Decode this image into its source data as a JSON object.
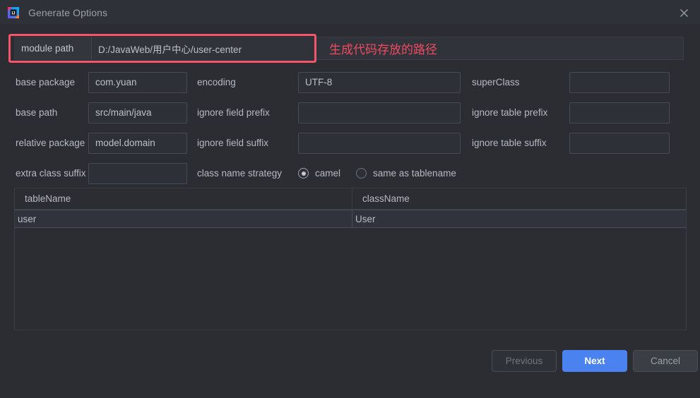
{
  "window": {
    "title": "Generate Options",
    "app_icon": "intellij-idea-icon",
    "close_icon": "close-icon"
  },
  "annotation": {
    "text": "生成代码存放的路径",
    "color": "#ef4b60",
    "highlight_color": "#f4556a"
  },
  "module_path": {
    "label": "module path",
    "value": "D:/JavaWeb/用户中心/user-center"
  },
  "form": {
    "rows": [
      {
        "left_label": "base package",
        "left_value": "com.yuan",
        "mid_label": "encoding",
        "mid_value": "UTF-8",
        "right_label": "superClass",
        "right_value": ""
      },
      {
        "left_label": "base path",
        "left_value": "src/main/java",
        "mid_label": "ignore field prefix",
        "mid_value": "",
        "right_label": "ignore table prefix",
        "right_value": ""
      },
      {
        "left_label": "relative package",
        "left_value": "model.domain",
        "mid_label": "ignore field suffix",
        "mid_value": "",
        "right_label": "ignore table suffix",
        "right_value": ""
      }
    ],
    "extra_class_suffix": {
      "label": "extra class suffix",
      "value": ""
    },
    "class_name_strategy": {
      "label": "class name strategy",
      "options": [
        {
          "label": "camel",
          "selected": true
        },
        {
          "label": "same as tablename",
          "selected": false
        }
      ]
    }
  },
  "table": {
    "columns": [
      "tableName",
      "className"
    ],
    "rows": [
      {
        "tableName": "user",
        "className": "User"
      }
    ]
  },
  "footer": {
    "previous_label": "Previous",
    "next_label": "Next",
    "cancel_label": "Cancel",
    "accent_color": "#4a82ef"
  }
}
